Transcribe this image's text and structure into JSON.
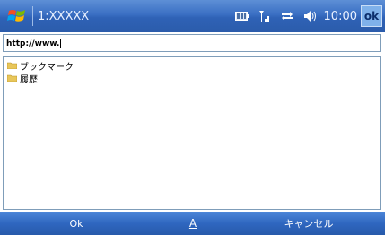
{
  "title_bar": {
    "app_title": "1:XXXXX",
    "clock": "10:00",
    "ok_label": "ok",
    "icons": [
      "windows-start-icon",
      "battery-icon",
      "signal-icon",
      "connectivity-icon",
      "volume-icon"
    ]
  },
  "address": {
    "value": "http://www."
  },
  "favorites": {
    "items": [
      {
        "label": "ブックマーク",
        "icon": "folder-icon"
      },
      {
        "label": "履歴",
        "icon": "folder-icon"
      }
    ]
  },
  "menu_bar": {
    "left_label": "Ok",
    "sip_label": "A",
    "right_label": "キャンセル"
  },
  "colors": {
    "titlebar": "#3a6fc3",
    "menubar": "#2f67c0",
    "folder": "#e8c65a"
  }
}
